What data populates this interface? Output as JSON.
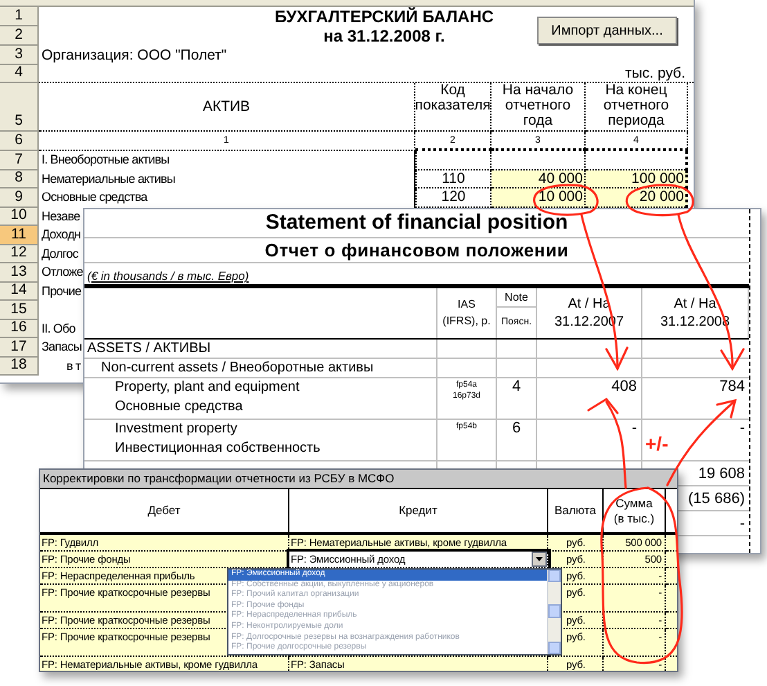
{
  "balance_sheet": {
    "title": "БУХГАЛТЕРСКИЙ БАЛАНС",
    "date": "на 31.12.2008 г.",
    "organization": "Организация: ООО \"Полет\"",
    "import_button": "Импорт данных...",
    "unit": "тыс. руб.",
    "row_numbers": [
      "1",
      "2",
      "3",
      "4",
      "5",
      "6"
    ],
    "columns": [
      {
        "label": "АКТИВ",
        "number": "1"
      },
      {
        "label": "Код показателя",
        "number": "2"
      },
      {
        "label": "На начало отчетного года",
        "number": "3"
      },
      {
        "label": "На конец отчетного периода",
        "number": "4"
      }
    ],
    "rows": [
      {
        "number": "7",
        "selected": false,
        "kind": "section",
        "label": "I. Внеоборотные активы"
      },
      {
        "number": "8",
        "selected": false,
        "kind": "item",
        "label": "Нематериальные активы",
        "code": "110",
        "start": "40 000",
        "end": "100 000"
      },
      {
        "number": "9",
        "selected": false,
        "kind": "item",
        "label": "Основные средства",
        "code": "120",
        "start": "10 000",
        "end": "20 000"
      },
      {
        "number": "10",
        "selected": false,
        "kind": "item",
        "label": "Незаве"
      },
      {
        "number": "11",
        "selected": true,
        "kind": "item",
        "label": "Доходн"
      },
      {
        "number": "12",
        "selected": false,
        "kind": "item",
        "label": "Долгос"
      },
      {
        "number": "13",
        "selected": false,
        "kind": "item",
        "label": "Отложе"
      },
      {
        "number": "14",
        "selected": false,
        "kind": "item",
        "label": "Прочие"
      },
      {
        "number": "15",
        "selected": false,
        "kind": "item"
      },
      {
        "number": "16",
        "selected": false,
        "kind": "section",
        "label": "II. Обо"
      },
      {
        "number": "17",
        "selected": false,
        "kind": "item",
        "label": "Запасы"
      },
      {
        "number": "18",
        "selected": false,
        "kind": "sub",
        "label": "в т"
      }
    ]
  },
  "statement": {
    "title": "Statement of financial position",
    "title_ru": "Отчет о финансовом положении",
    "currency_note": "(€ in thousands / в тыс. Евро)",
    "columns": [
      {
        "label": "IAS (IFRS), p."
      },
      {
        "label": "Note",
        "sublabel": "Поясн."
      },
      {
        "label": "At / На",
        "date": "31.12.2007"
      },
      {
        "label": "At / На",
        "date": "31.12.2008"
      }
    ],
    "rows": [
      {
        "kind": "section",
        "label": "ASSETS / АКТИВЫ"
      },
      {
        "kind": "group",
        "label": "Non-current assets / Внеоборотные активы"
      },
      {
        "kind": "item",
        "label": "Property, plant and equipment",
        "label_ru": "Основные средства",
        "ias": [
          "fp54a",
          "16p73d"
        ],
        "note": "4",
        "prior": "408",
        "current": "784"
      },
      {
        "kind": "item",
        "label": "Investment property",
        "label_ru": "Инвестиционная собственность",
        "ias": [
          "fp54b"
        ],
        "note": "6",
        "prior": "-",
        "current": "-"
      },
      {
        "kind": "value",
        "current": "19 608"
      },
      {
        "kind": "value",
        "current": "(15 686)"
      },
      {
        "kind": "value",
        "current": "-"
      }
    ]
  },
  "adjustments": {
    "title": "Корректировки по трансформации отчетности из РСБУ в МСФО",
    "columns": [
      "Дебет",
      "Кредит",
      "Валюта",
      "Сумма (в тыс.)"
    ],
    "rows": [
      {
        "kind": "single",
        "debit": "FP: Гудвилл",
        "credit": "FP: Нематериальные активы, кроме гудвилла",
        "currency": "руб.",
        "amount": "500 000"
      },
      {
        "kind": "single",
        "debit": "FP: Прочие фонды",
        "credit": "FP: Эмиссионный доход",
        "currency": "руб.",
        "amount": "500",
        "options": [
          {
            "label": "FP: Эмиссионный доход",
            "selected": true
          },
          {
            "label": "FP: Собственные акции, выкупленные у акционеров",
            "selected": false
          },
          {
            "label": "FP: Прочий капитал организации",
            "selected": false
          },
          {
            "label": "FP: Прочие фонды",
            "selected": false
          },
          {
            "label": "FP: Нераспределенная прибыль",
            "selected": false
          },
          {
            "label": "FP: Неконтролируемые доли",
            "selected": false
          },
          {
            "label": "FP: Долгосрочные резервы на вознаграждения работников",
            "selected": false
          },
          {
            "label": "FP: Прочие долгосрочные резервы",
            "selected": false
          }
        ]
      },
      {
        "kind": "single",
        "debit": "FP: Нераспределенная прибыль",
        "currency": "руб.",
        "amount": "-"
      },
      {
        "kind": "tall",
        "debit": "FP: Прочие краткосрочные резервы",
        "currency": "руб.",
        "amount": "-"
      },
      {
        "kind": "single",
        "debit": "FP: Прочие краткосрочные резервы",
        "currency": "руб.",
        "amount": "-"
      },
      {
        "kind": "tall",
        "debit": "FP: Прочие краткосрочные резервы",
        "currency": "руб.",
        "amount": "-"
      },
      {
        "kind": "single",
        "debit": "FP: Нематериальные активы, кроме гудвилла",
        "credit": "FP: Запасы",
        "currency": "руб.",
        "amount": "-"
      }
    ]
  },
  "annotation_label": "+/-"
}
